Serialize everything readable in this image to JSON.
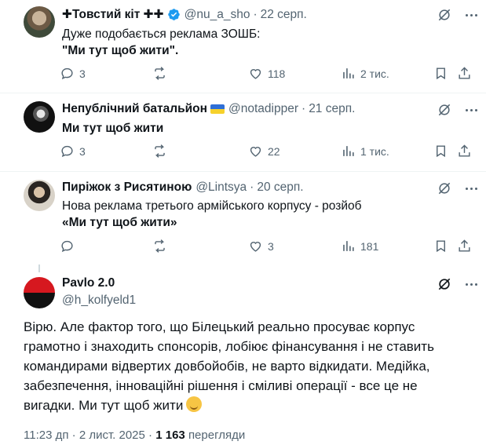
{
  "replies": [
    {
      "name": "✚Товстий кіт ✚✚",
      "handle": "@nu_a_sho",
      "date": "22 серп.",
      "verified": true,
      "text_line1": "Дуже подобається реклама ЗОШБ:",
      "text_line2": "\"Ми тут щоб жити\".",
      "replies_count": "3",
      "reposts_count": "",
      "likes_count": "118",
      "views_count": "2 тис."
    },
    {
      "name": "Непублічний батальйон",
      "handle": "@notadipper",
      "date": "21 серп.",
      "flag": "ukraine-flag",
      "text_line1": "Ми тут щоб жити",
      "replies_count": "3",
      "reposts_count": "",
      "likes_count": "22",
      "views_count": "1 тис."
    },
    {
      "name": "Пиріжок з Рисятиною",
      "handle": "@Lintsya",
      "date": "20 серп.",
      "text_line1": "Нова реклама третього армійського корпусу - розйоб",
      "text_line2": "«Ми тут щоб жити»",
      "replies_count": "",
      "reposts_count": "",
      "likes_count": "3",
      "views_count": "181"
    }
  ],
  "main": {
    "name": "Pavlo 2.0",
    "handle": "@h_kolfyeld1",
    "body_lines": [
      "Вірю. Але фактор того, що Білецький реально просуває корпус",
      "грамотно і знаходить спонсорів, лобіює фінансування і не ставить",
      "командирами відвертих довбойобів, не варто відкидати. Медійка,",
      "забезпечення, інноваційні рішення і сміливі операції - все це не",
      "вигадки. Ми тут щоб жити"
    ],
    "time": "11:23 дп",
    "separator": " · ",
    "date": "2 лист. 2025",
    "views_number": "1 163",
    "views_label": "перегляди",
    "emoji": "saluting-face"
  },
  "icons": [
    "grok-icon",
    "more-icon",
    "reply-icon",
    "repost-icon",
    "like-icon",
    "views-icon",
    "bookmark-icon",
    "share-icon"
  ],
  "colors": {
    "text": "#0f1419",
    "secondary": "#536471",
    "verified": "#1d9bf0"
  }
}
